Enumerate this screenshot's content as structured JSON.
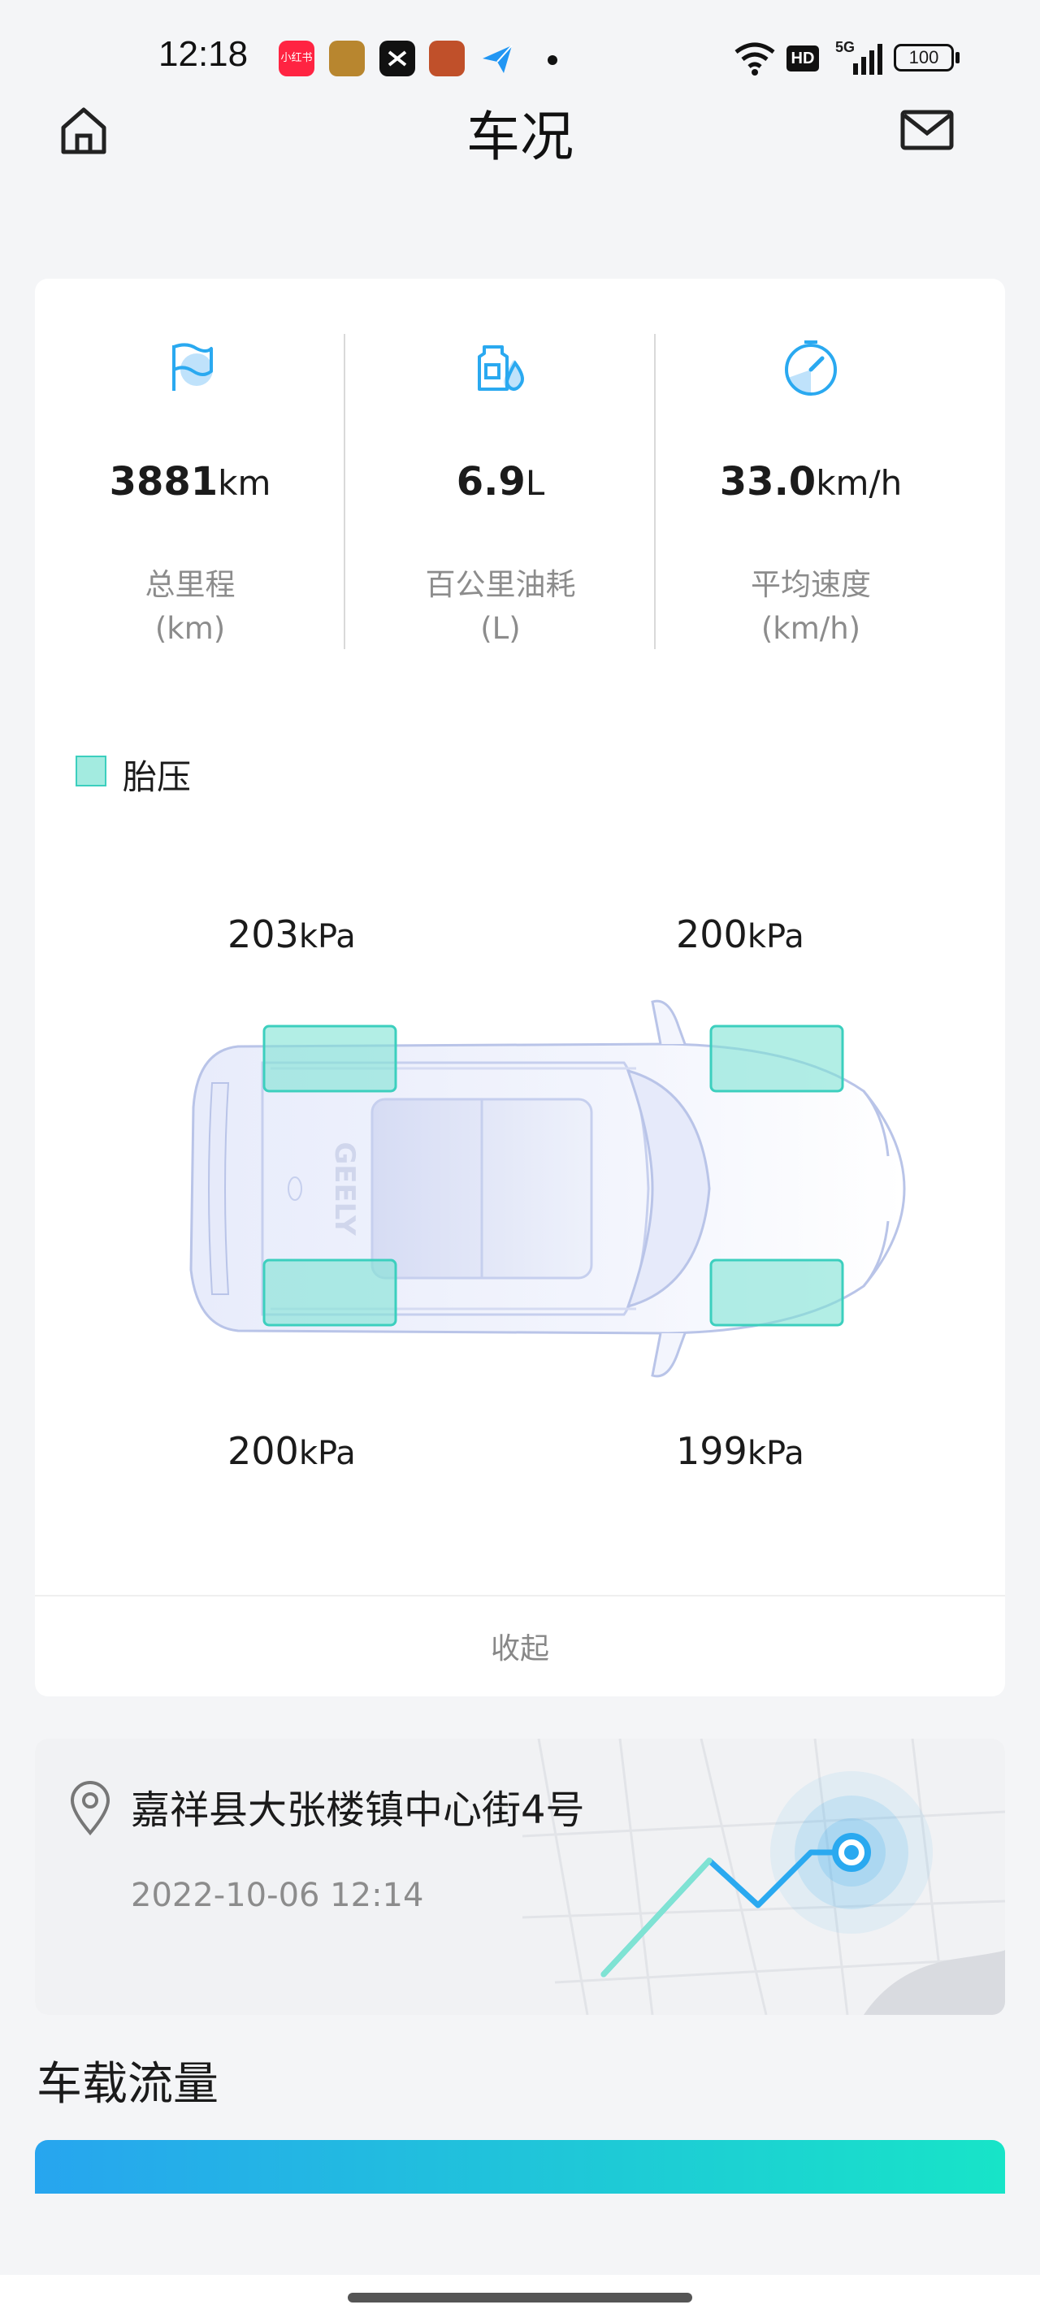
{
  "status_bar": {
    "time": "12:18",
    "apps": [
      {
        "icon": "xiaohongshu-icon",
        "color": "#ff2442",
        "text": "小红书"
      },
      {
        "icon": "game-icon-1",
        "color": "#b8862f"
      },
      {
        "icon": "capcut-icon",
        "color": "#111111"
      },
      {
        "icon": "game-icon-2",
        "color": "#c0502a"
      },
      {
        "icon": "paper-plane-icon",
        "color": "#2196f3"
      }
    ],
    "network_label": "5G",
    "hd_label": "HD",
    "battery": "100"
  },
  "header": {
    "title": "车况"
  },
  "stats": [
    {
      "icon": "flag-icon",
      "value": "3881",
      "unit": "km",
      "label": "总里程",
      "sublabel": "(km)"
    },
    {
      "icon": "fuel-icon",
      "value": "6.9",
      "unit": "L",
      "label": "百公里油耗",
      "sublabel": "(L)"
    },
    {
      "icon": "speedometer-icon",
      "value": "33.0",
      "unit": "km/h",
      "label": "平均速度",
      "sublabel": "(km/h)"
    }
  ],
  "tire_pressure": {
    "legend": "胎压",
    "unit": "kPa",
    "front_left": "203",
    "front_right": "200",
    "rear_left": "200",
    "rear_right": "199",
    "brand": "GEELY"
  },
  "collapse_label": "收起",
  "location": {
    "address": "嘉祥县大张楼镇中心街4号",
    "time": "2022-10-06 12:14"
  },
  "traffic_section": {
    "title": "车载流量"
  },
  "colors": {
    "accent": "#2aa9f0",
    "tire_fill": "#a3ebe0",
    "tire_stroke": "#3ccfbe"
  }
}
